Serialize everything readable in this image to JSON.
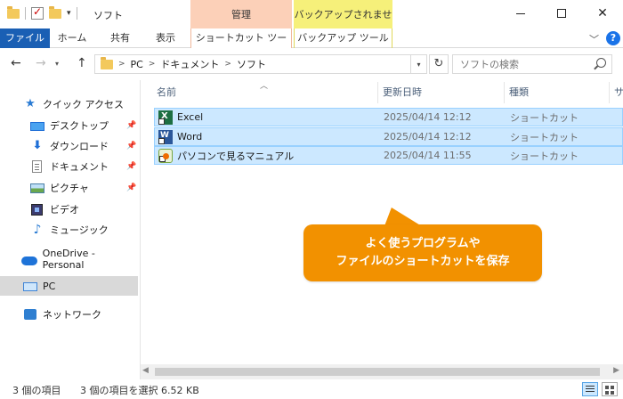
{
  "titlebar": {
    "title": "ソフト",
    "ctx_manage": "管理",
    "ctx_backup": "バックアップされません"
  },
  "ribbon": {
    "file": "ファイル",
    "home": "ホーム",
    "share": "共有",
    "view": "表示",
    "shortcut_tools": "ショートカット ツール",
    "backup_tools": "バックアップ ツール",
    "help": "?"
  },
  "address": {
    "segments": [
      "PC",
      "ドキュメント",
      "ソフト"
    ],
    "search_placeholder": "ソフトの検索"
  },
  "sidebar": {
    "quick_access": "クイック アクセス",
    "items": [
      "デスクトップ",
      "ダウンロード",
      "ドキュメント",
      "ピクチャ",
      "ビデオ",
      "ミュージック"
    ],
    "onedrive": "OneDrive - Personal",
    "pc": "PC",
    "network": "ネットワーク"
  },
  "columns": {
    "name": "名前",
    "date": "更新日時",
    "type": "種類",
    "size": "サ"
  },
  "files": [
    {
      "name": "Excel",
      "date": "2025/04/14 12:12",
      "type": "ショートカット"
    },
    {
      "name": "Word",
      "date": "2025/04/14 12:12",
      "type": "ショートカット"
    },
    {
      "name": "パソコンで見るマニュアル",
      "date": "2025/04/14 11:55",
      "type": "ショートカット"
    }
  ],
  "status": {
    "count": "3 個の項目",
    "selected": "3 個の項目を選択  6.52 KB"
  },
  "callout": {
    "line1": "よく使うプログラムや",
    "line2": "ファイルのショートカットを保存"
  },
  "colors": {
    "file_tab": "#1a5fb4",
    "ctx_manage": "#fcd0b8",
    "ctx_backup": "#f6f07a",
    "selection": "#cce8ff",
    "callout": "#f29100"
  }
}
